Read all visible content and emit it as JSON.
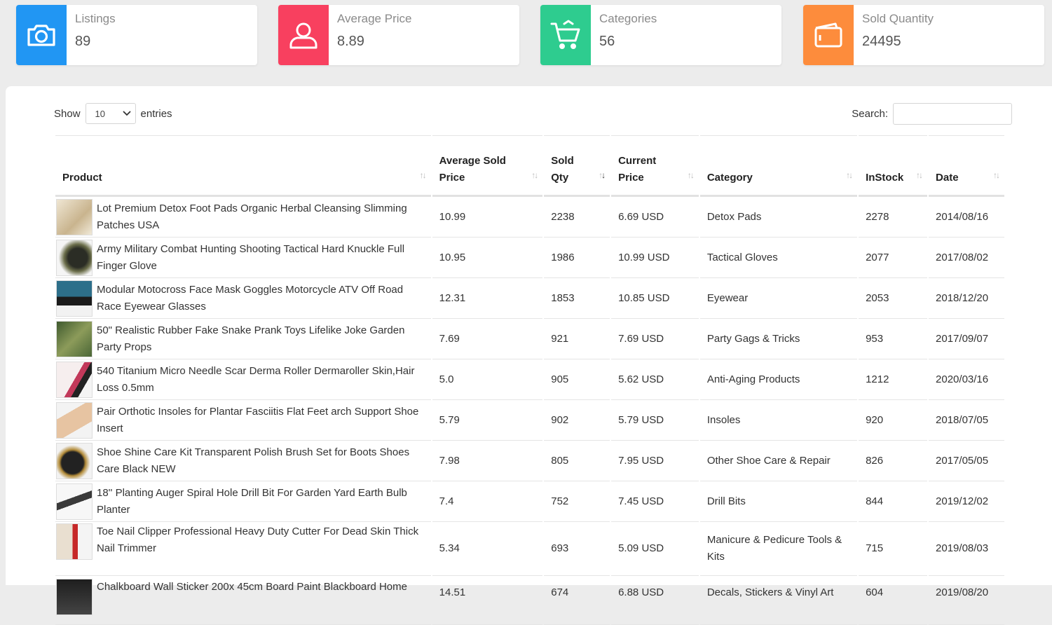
{
  "cards": [
    {
      "label": "Listings",
      "value": "89",
      "color": "#2196f3",
      "icon": "camera-icon"
    },
    {
      "label": "Average Price",
      "value": "8.89",
      "color": "#f8405f",
      "icon": "user-icon"
    },
    {
      "label": "Categories",
      "value": "56",
      "color": "#2ecc8f",
      "icon": "cart-icon"
    },
    {
      "label": "Sold Quantity",
      "value": "24495",
      "color": "#fd8c3c",
      "icon": "wallet-icon"
    }
  ],
  "controls": {
    "show_label": "Show",
    "entries_value": "10",
    "entries_label": "entries",
    "search_label": "Search:",
    "search_value": ""
  },
  "columns": [
    {
      "label": "Product"
    },
    {
      "label": "Average Sold Price"
    },
    {
      "label": "Sold Qty"
    },
    {
      "label": "Current Price"
    },
    {
      "label": "Category"
    },
    {
      "label": "InStock"
    },
    {
      "label": "Date"
    }
  ],
  "rows": [
    {
      "product": "Lot Premium Detox Foot Pads Organic Herbal Cleansing Slimming Patches USA",
      "avg": "10.99",
      "qty": "2238",
      "price": "6.69 USD",
      "category": "Detox Pads",
      "instock": "2278",
      "date": "2014/08/16"
    },
    {
      "product": "Army Military Combat Hunting Shooting Tactical Hard Knuckle Full Finger Glove",
      "avg": "10.95",
      "qty": "1986",
      "price": "10.99 USD",
      "category": "Tactical Gloves",
      "instock": "2077",
      "date": "2017/08/02"
    },
    {
      "product": "Modular Motocross Face Mask Goggles Motorcycle ATV Off Road Race Eyewear Glasses",
      "avg": "12.31",
      "qty": "1853",
      "price": "10.85 USD",
      "category": "Eyewear",
      "instock": "2053",
      "date": "2018/12/20"
    },
    {
      "product": "50\" Realistic Rubber Fake Snake Prank Toys Lifelike Joke Garden Party Props",
      "avg": "7.69",
      "qty": "921",
      "price": "7.69 USD",
      "category": "Party Gags & Tricks",
      "instock": "953",
      "date": "2017/09/07"
    },
    {
      "product": "540 Titanium Micro Needle Scar Derma Roller Dermaroller Skin,Hair Loss 0.5mm",
      "avg": "5.0",
      "qty": "905",
      "price": "5.62 USD",
      "category": "Anti-Aging Products",
      "instock": "1212",
      "date": "2020/03/16"
    },
    {
      "product": "Pair Orthotic Insoles for Plantar Fasciitis Flat Feet arch Support Shoe Insert",
      "avg": "5.79",
      "qty": "902",
      "price": "5.79 USD",
      "category": "Insoles",
      "instock": "920",
      "date": "2018/07/05"
    },
    {
      "product": "Shoe Shine Care Kit Transparent Polish Brush Set for Boots Shoes Care Black NEW",
      "avg": "7.98",
      "qty": "805",
      "price": "7.95 USD",
      "category": "Other Shoe Care & Repair",
      "instock": "826",
      "date": "2017/05/05"
    },
    {
      "product": "18'' Planting Auger Spiral Hole Drill Bit For Garden Yard Earth Bulb Planter",
      "avg": "7.4",
      "qty": "752",
      "price": "7.45 USD",
      "category": "Drill Bits",
      "instock": "844",
      "date": "2019/12/02"
    },
    {
      "product": "Toe Nail Clipper Professional Heavy Duty Cutter For Dead Skin Thick Nail Trimmer",
      "avg": "5.34",
      "qty": "693",
      "price": "5.09 USD",
      "category": "Manicure & Pedicure Tools & Kits",
      "instock": "715",
      "date": "2019/08/03"
    },
    {
      "product": "Chalkboard Wall Sticker 200x 45cm Board Paint Blackboard Home",
      "avg": "14.51",
      "qty": "674",
      "price": "6.88 USD",
      "category": "Decals, Stickers & Vinyl Art",
      "instock": "604",
      "date": "2019/08/20"
    }
  ]
}
